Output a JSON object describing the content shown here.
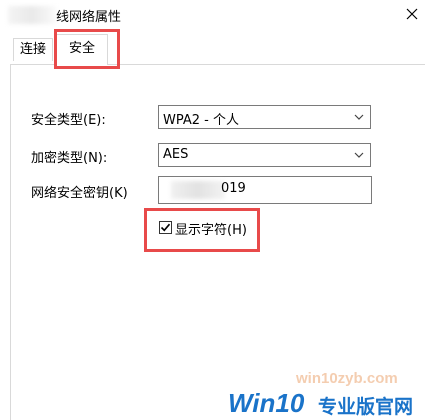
{
  "window": {
    "title": "线网络属性",
    "close_icon": "close-icon"
  },
  "tabs": [
    {
      "label": "连接",
      "selected": false
    },
    {
      "label": "安全",
      "selected": true
    }
  ],
  "security": {
    "type_label": "安全类型(E):",
    "type_value": "WPA2 - 个人",
    "encryption_label": "加密类型(N):",
    "encryption_value": "AES",
    "key_label": "网络安全密钥(K)",
    "key_value": "019",
    "show_chars_label": "显示字符(H)",
    "show_chars_checked": true
  },
  "watermark": {
    "site": "win10zyb.com",
    "brand": "Win10",
    "brand_suffix": "专业版官网"
  },
  "colors": {
    "highlight": "#e84a4a",
    "watermark_blue": "#1a73c9"
  }
}
